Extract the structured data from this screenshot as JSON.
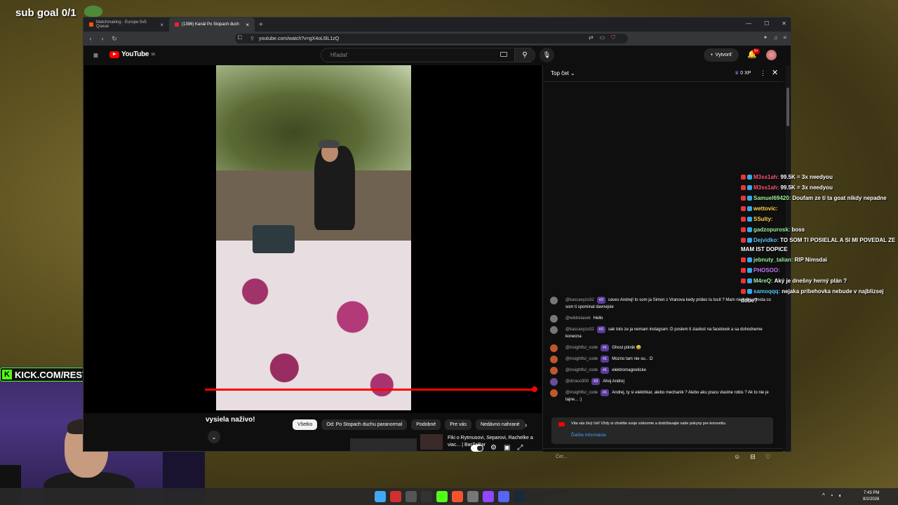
{
  "overlay": {
    "sub_goal": "sub goal 0/1",
    "kick_url": "KICK.COM/RESTT"
  },
  "browser": {
    "tabs": [
      {
        "label": "Matchmaking - Europe 5v5 Queue"
      },
      {
        "label": "(1396) Kanál Po Stopach duch"
      }
    ],
    "url": "youtube.com/watch?v=gX4oL6lL1zQ"
  },
  "youtube": {
    "logo": "YouTube",
    "logo_sup": "SK",
    "search_placeholder": "Hľadať",
    "create_label": "Vytvoriť",
    "notif_count": "9+",
    "live_label": "vysiela naživo!",
    "chips": [
      "Všetko",
      "Od: Po Stopach duchu paranormal",
      "Podobné",
      "Pre vás",
      "Nedávno nahrané"
    ],
    "recommendation_title": "Fiki o Rytmusovi, Separovi, Rachelke a viac... | BarZaBar",
    "live_progress": 1.0
  },
  "chat": {
    "title": "Top čet",
    "xp": "0 XP",
    "messages": [
      {
        "author": "@kascaxyzo32",
        "badge": "#2",
        "text": "caves Andrej! to som ja Simon z Vranova kedy prides tu tocit ? Mam niekolko miesta co som ti spominal davnejsie",
        "avatar": "gray"
      },
      {
        "author": "@wildrelaxek",
        "badge": "",
        "text": "Hello",
        "avatar": "gray"
      },
      {
        "author": "@kascaxyzo32",
        "badge": "#2",
        "text": "sak toto ze ja nemam instagram :D poslem ti ziadost na facebook a sa dohodneme konecna",
        "avatar": "gray"
      },
      {
        "author": "@insightful_code",
        "badge": "#1",
        "text": "Ghost piknik 😀",
        "avatar": "orange"
      },
      {
        "author": "@insightful_code",
        "badge": "#1",
        "text": "Mozno tam nie su.. :D",
        "avatar": "orange"
      },
      {
        "author": "@insightful_code",
        "badge": "#1",
        "text": "elektromagneticke",
        "avatar": "orange"
      },
      {
        "author": "@drraco300",
        "badge": "#3",
        "text": "Ahoj Andrej",
        "avatar": "purple"
      },
      {
        "author": "@insightful_code",
        "badge": "#1",
        "text": "Andrej, ty si elektrikar, alebo mechanik ? Alebo aku pracu vlastne robis ? Ak to nie je tajne... :)",
        "avatar": "orange"
      }
    ],
    "notice_text": "Vita vás živý čet! Vždy si chráňte svoje súkromie a dodržiavajte naše pokyny pre komunitu.",
    "notice_link": "Ďalšie informácie",
    "input_placeholder": "Čet..."
  },
  "overlay_chat": [
    {
      "name": "M3ss1ah:",
      "text": "99.5K = 3x needyou",
      "color": "#ff5577"
    },
    {
      "name": "M3ss1ah:",
      "text": "99.5K = 3x needyou",
      "color": "#ff5577"
    },
    {
      "name": "Samuel69420:",
      "text": "Doufam ze ti ta goat nikdy nepadne",
      "color": "#9df39d"
    },
    {
      "name": "wettovic:",
      "text": "",
      "color": "#ffd84d"
    },
    {
      "name": "SSulty:",
      "text": "",
      "color": "#ffd84d"
    },
    {
      "name": "gadzopurosk:",
      "text": "boss",
      "color": "#9df39d"
    },
    {
      "name": "Dejvidko:",
      "text": "TO SOM TI POSIELAL A SI MI POVEDAL ZE MAM IST DOPICE",
      "color": "#5ac8fa"
    },
    {
      "name": "jebnuty_talian:",
      "text": "RIP Nimsdai",
      "color": "#9df39d"
    },
    {
      "name": "PHOSOO:",
      "text": "",
      "color": "#c37cff"
    },
    {
      "name": "M4reQ:",
      "text": "Aký je dnešny herný plán ?",
      "color": "#9df39d"
    },
    {
      "name": "samoqqq:",
      "text": "nejaka pribehovka nebude v najblizsej dobe?",
      "color": "#5ac8fa"
    }
  ],
  "clock": {
    "time": "7:43 PM",
    "date": "8/2/2026"
  }
}
